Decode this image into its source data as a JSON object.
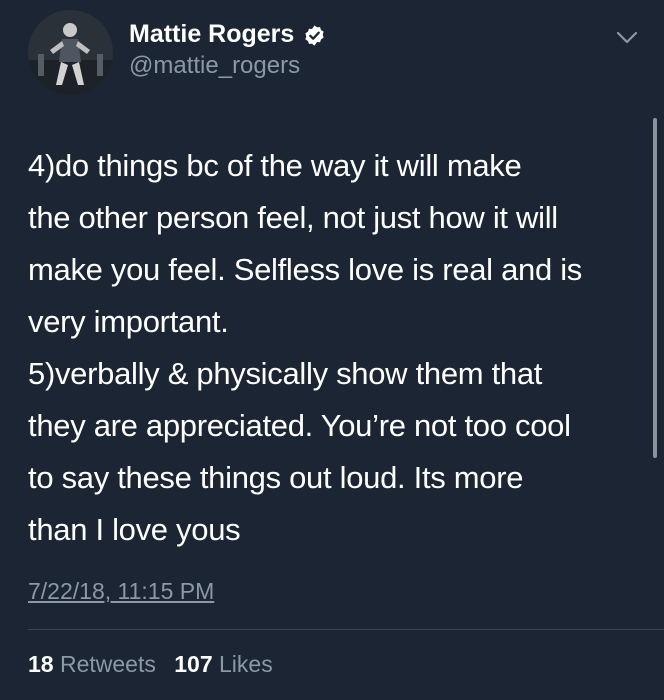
{
  "user": {
    "display_name": "Mattie Rogers",
    "handle": "@mattie_rogers"
  },
  "tweet": {
    "lines": [
      "4)do things bc of the way it will make",
      "the other person feel, not just how it will",
      "make you feel. Selfless love is real and is",
      "very important.",
      "5)verbally & physically show them that",
      "they are appreciated. You’re not too cool",
      "to say these things out loud. Its more",
      "than I love yous"
    ],
    "timestamp": "7/22/18, 11:15 PM"
  },
  "stats": {
    "retweets_count": "18",
    "retweets_label": "Retweets",
    "likes_count": "107",
    "likes_label": "Likes"
  },
  "icons": {
    "verified": "verified-badge-icon",
    "caret": "chevron-down-icon"
  },
  "colors": {
    "background": "#1b2533",
    "text_primary": "#ffffff",
    "text_secondary": "#8b98a5",
    "divider": "#38444d"
  }
}
